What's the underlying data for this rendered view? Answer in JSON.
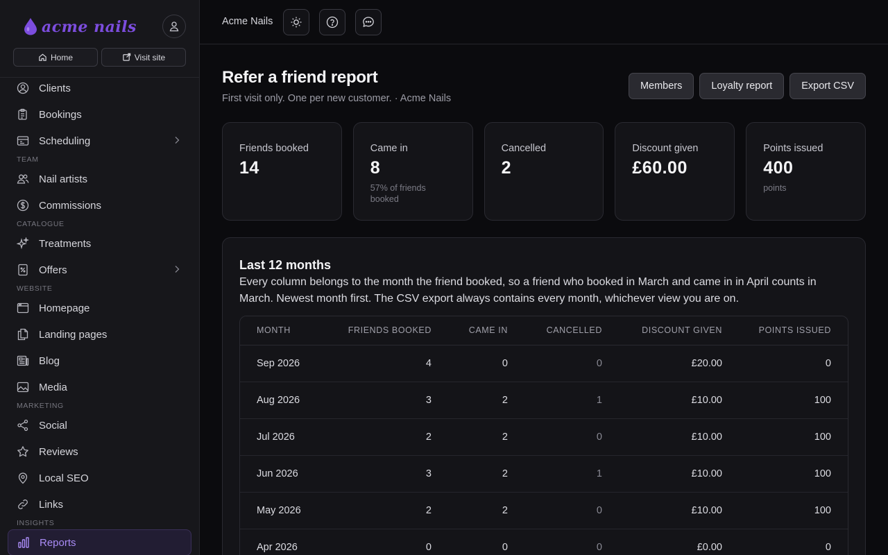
{
  "brand": {
    "name": "acme nails",
    "color": "#7c4dde"
  },
  "sidebar": {
    "top_links": [
      {
        "label": "Home",
        "icon": "home-icon"
      },
      {
        "label": "Visit site",
        "icon": "external-link-icon"
      }
    ],
    "items": [
      {
        "label": "Clients",
        "icon": "user-circle-icon"
      },
      {
        "label": "Bookings",
        "icon": "clipboard-icon"
      },
      {
        "label": "Scheduling",
        "icon": "calendar-icon"
      },
      {
        "label": "Nail artists",
        "icon": "users-icon"
      },
      {
        "label": "Commissions",
        "icon": "dollar-icon"
      },
      {
        "label": "Treatments",
        "icon": "sparkles-icon"
      },
      {
        "label": "Offers",
        "icon": "percent-tag-icon"
      },
      {
        "label": "Homepage",
        "icon": "browser-icon"
      },
      {
        "label": "Landing pages",
        "icon": "pages-icon"
      },
      {
        "label": "Blog",
        "icon": "newspaper-icon"
      },
      {
        "label": "Media",
        "icon": "image-icon"
      },
      {
        "label": "Social",
        "icon": "share-icon"
      },
      {
        "label": "Reviews",
        "icon": "star-icon"
      },
      {
        "label": "Local SEO",
        "icon": "map-pin-icon"
      },
      {
        "label": "Links",
        "icon": "link-icon"
      },
      {
        "label": "Reports",
        "icon": "bar-chart-icon"
      }
    ],
    "sections": [
      "TEAM",
      "CATALOGUE",
      "WEBSITE",
      "MARKETING",
      "INSIGHTS"
    ]
  },
  "header": {
    "title": "Acme Nails"
  },
  "page": {
    "title": "Refer a friend report",
    "subtitle": "First visit only. One per new customer. · Acme Nails",
    "actions": [
      "Members",
      "Loyalty report",
      "Export CSV"
    ]
  },
  "stats": [
    {
      "label": "Friends booked",
      "value": "14",
      "note": ""
    },
    {
      "label": "Came in",
      "value": "8",
      "note": "57% of friends booked"
    },
    {
      "label": "Cancelled",
      "value": "2",
      "note": ""
    },
    {
      "label": "Discount given",
      "value": "£60.00",
      "note": ""
    },
    {
      "label": "Points issued",
      "value": "400",
      "note": "points"
    }
  ],
  "panel": {
    "title": "Last 12 months",
    "description": "Every column belongs to the month the friend booked, so a friend who booked in March and came in in April counts in March. Newest month first. The CSV export always contains every month, whichever view you are on."
  },
  "table": {
    "headers": [
      "Month",
      "Friends booked",
      "Came in",
      "Cancelled",
      "Discount given",
      "Points issued"
    ],
    "rows": [
      [
        "Sep 2026",
        "4",
        "0",
        "0",
        "£20.00",
        "0"
      ],
      [
        "Aug 2026",
        "3",
        "2",
        "1",
        "£10.00",
        "100"
      ],
      [
        "Jul 2026",
        "2",
        "2",
        "0",
        "£10.00",
        "100"
      ],
      [
        "Jun 2026",
        "3",
        "2",
        "1",
        "£10.00",
        "100"
      ],
      [
        "May 2026",
        "2",
        "2",
        "0",
        "£10.00",
        "100"
      ],
      [
        "Apr 2026",
        "0",
        "0",
        "0",
        "£0.00",
        "0"
      ]
    ]
  }
}
